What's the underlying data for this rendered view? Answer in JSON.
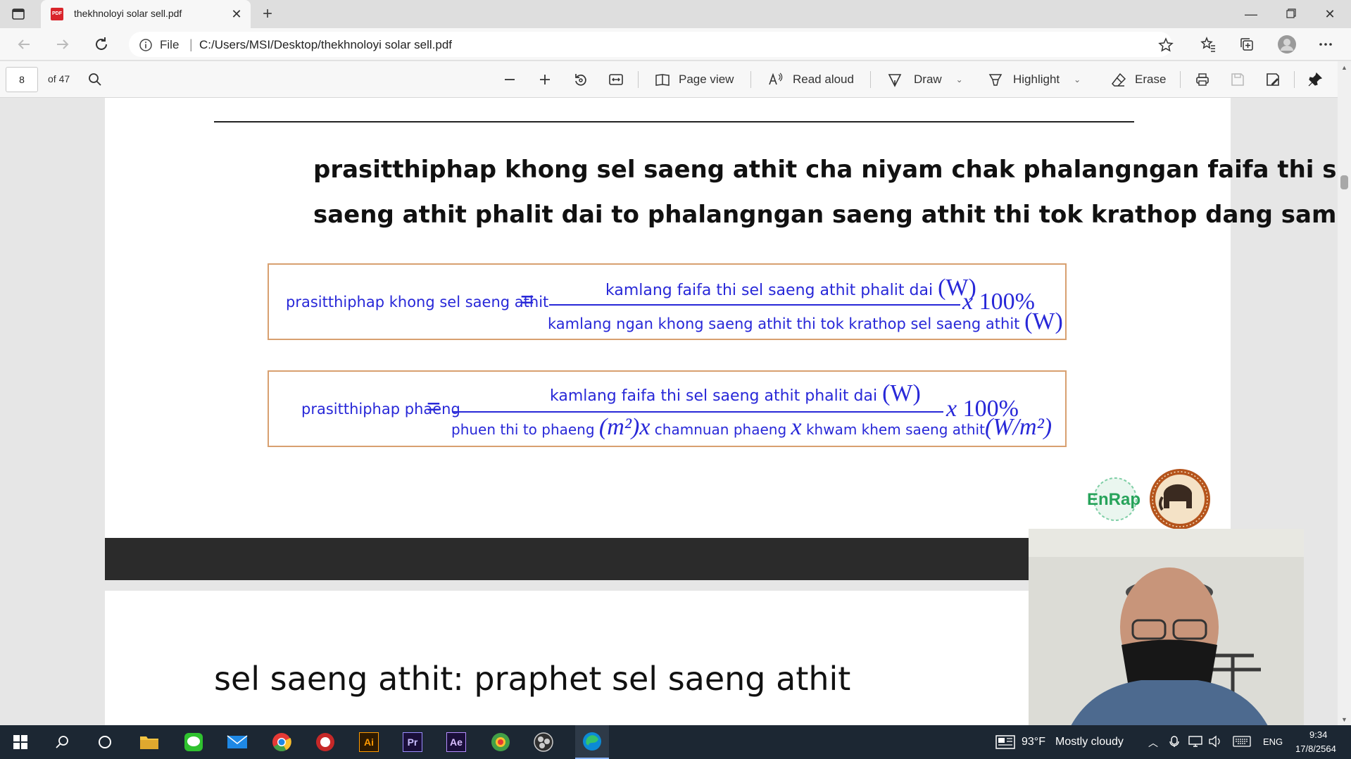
{
  "browser": {
    "tab_title": "thekhnoloyi solar sell.pdf",
    "new_tab_label": "+",
    "address": {
      "scheme_label": "File",
      "url": "C:/Users/MSI/Desktop/thekhnoloyi solar sell.pdf"
    }
  },
  "pdf_toolbar": {
    "current_page": "8",
    "total_pages": "of 47",
    "page_view_label": "Page view",
    "read_aloud_label": "Read aloud",
    "draw_label": "Draw",
    "highlight_label": "Highlight",
    "erase_label": "Erase"
  },
  "document": {
    "page1": {
      "heading_line1": "prasitthiphap khong sel saeng athit cha niyam chak phalangngan faifa thi sel",
      "heading_line2": "saeng athit phalit dai to phalangngan saeng athit thi tok krathop dang samkan",
      "equation1": {
        "lhs": "prasitthiphap khong sel saeng athit",
        "equals": "=",
        "numerator_text": "kamlang faifa thi sel saeng athit phalit dai",
        "numerator_unit": "(W)",
        "denominator_text": "kamlang ngan khong saeng athit thi tok krathop sel saeng athit",
        "denominator_unit": "(W)",
        "tail_x": "x",
        "tail_percent": "100%"
      },
      "equation2": {
        "lhs": "prasitthiphap phaeng",
        "equals": "=",
        "numerator_text": "kamlang faifa thi sel saeng athit phalit dai",
        "numerator_unit": "(W)",
        "den_part1": "phuen thi to phaeng",
        "den_unit1": "(m²)",
        "den_x1": "x",
        "den_part2": "chamnuan phaeng",
        "den_x2": "x",
        "den_part3": "khwam khem saeng athit",
        "den_unit3": "(W/m²)",
        "tail_x": "x",
        "tail_percent": "100%"
      },
      "logo_text": "EnRap"
    },
    "page2": {
      "title": "sel saeng athit: praphet sel saeng athit"
    }
  },
  "taskbar": {
    "weather_temp": "93°F",
    "weather_desc": "Mostly cloudy",
    "language": "ENG",
    "time": "9:34",
    "date": "17/8/2564",
    "app_ai": "Ai",
    "app_pr": "Pr",
    "app_ae": "Ae"
  },
  "colors": {
    "equation_blue": "#2828d8",
    "box_border": "#d8a070",
    "pdf_icon_red": "#d9252b",
    "taskbar_bg": "#1c2733"
  }
}
